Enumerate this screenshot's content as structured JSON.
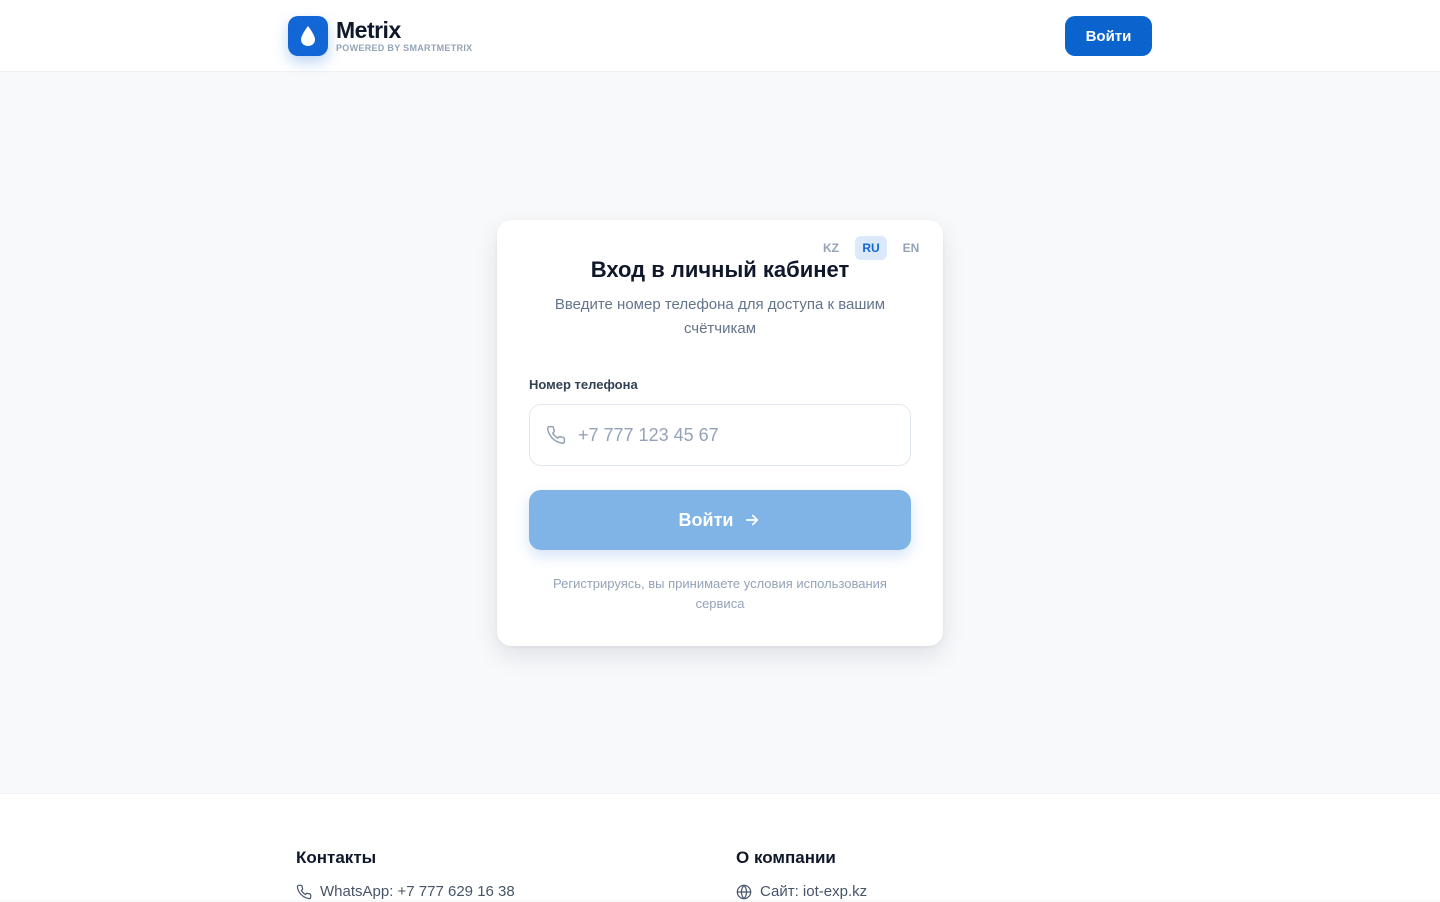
{
  "header": {
    "logo_icon": "water-drop-icon",
    "logo_name": "Metrix",
    "logo_tagline": "POWERED BY SMARTMETRIX",
    "login_label": "Войти"
  },
  "login_card": {
    "languages": [
      {
        "code": "KZ",
        "active": false
      },
      {
        "code": "RU",
        "active": true
      },
      {
        "code": "EN",
        "active": false
      }
    ],
    "title": "Вход в личный кабинет",
    "subtitle": "Введите номер телефона для доступа к вашим счётчикам",
    "phone_label": "Номер телефона",
    "phone_icon": "phone-icon",
    "phone_placeholder": "+7 777 123 45 67",
    "phone_value": "",
    "submit_label": "Войти",
    "submit_icon": "arrow-right-icon",
    "terms_text": "Регистрируясь, вы принимаете условия использования сервиса"
  },
  "footer": {
    "contacts_heading": "Контакты",
    "whatsapp": "WhatsApp: +7 777 629 16 38",
    "company_heading": "О компании",
    "website": "Сайт: iot-exp.kz"
  },
  "colors": {
    "brand": "#0b63ce",
    "brand_disabled": "#80b3e6",
    "active_lang_bg": "#dbe9fb",
    "page_bg": "#f7f9fb"
  }
}
